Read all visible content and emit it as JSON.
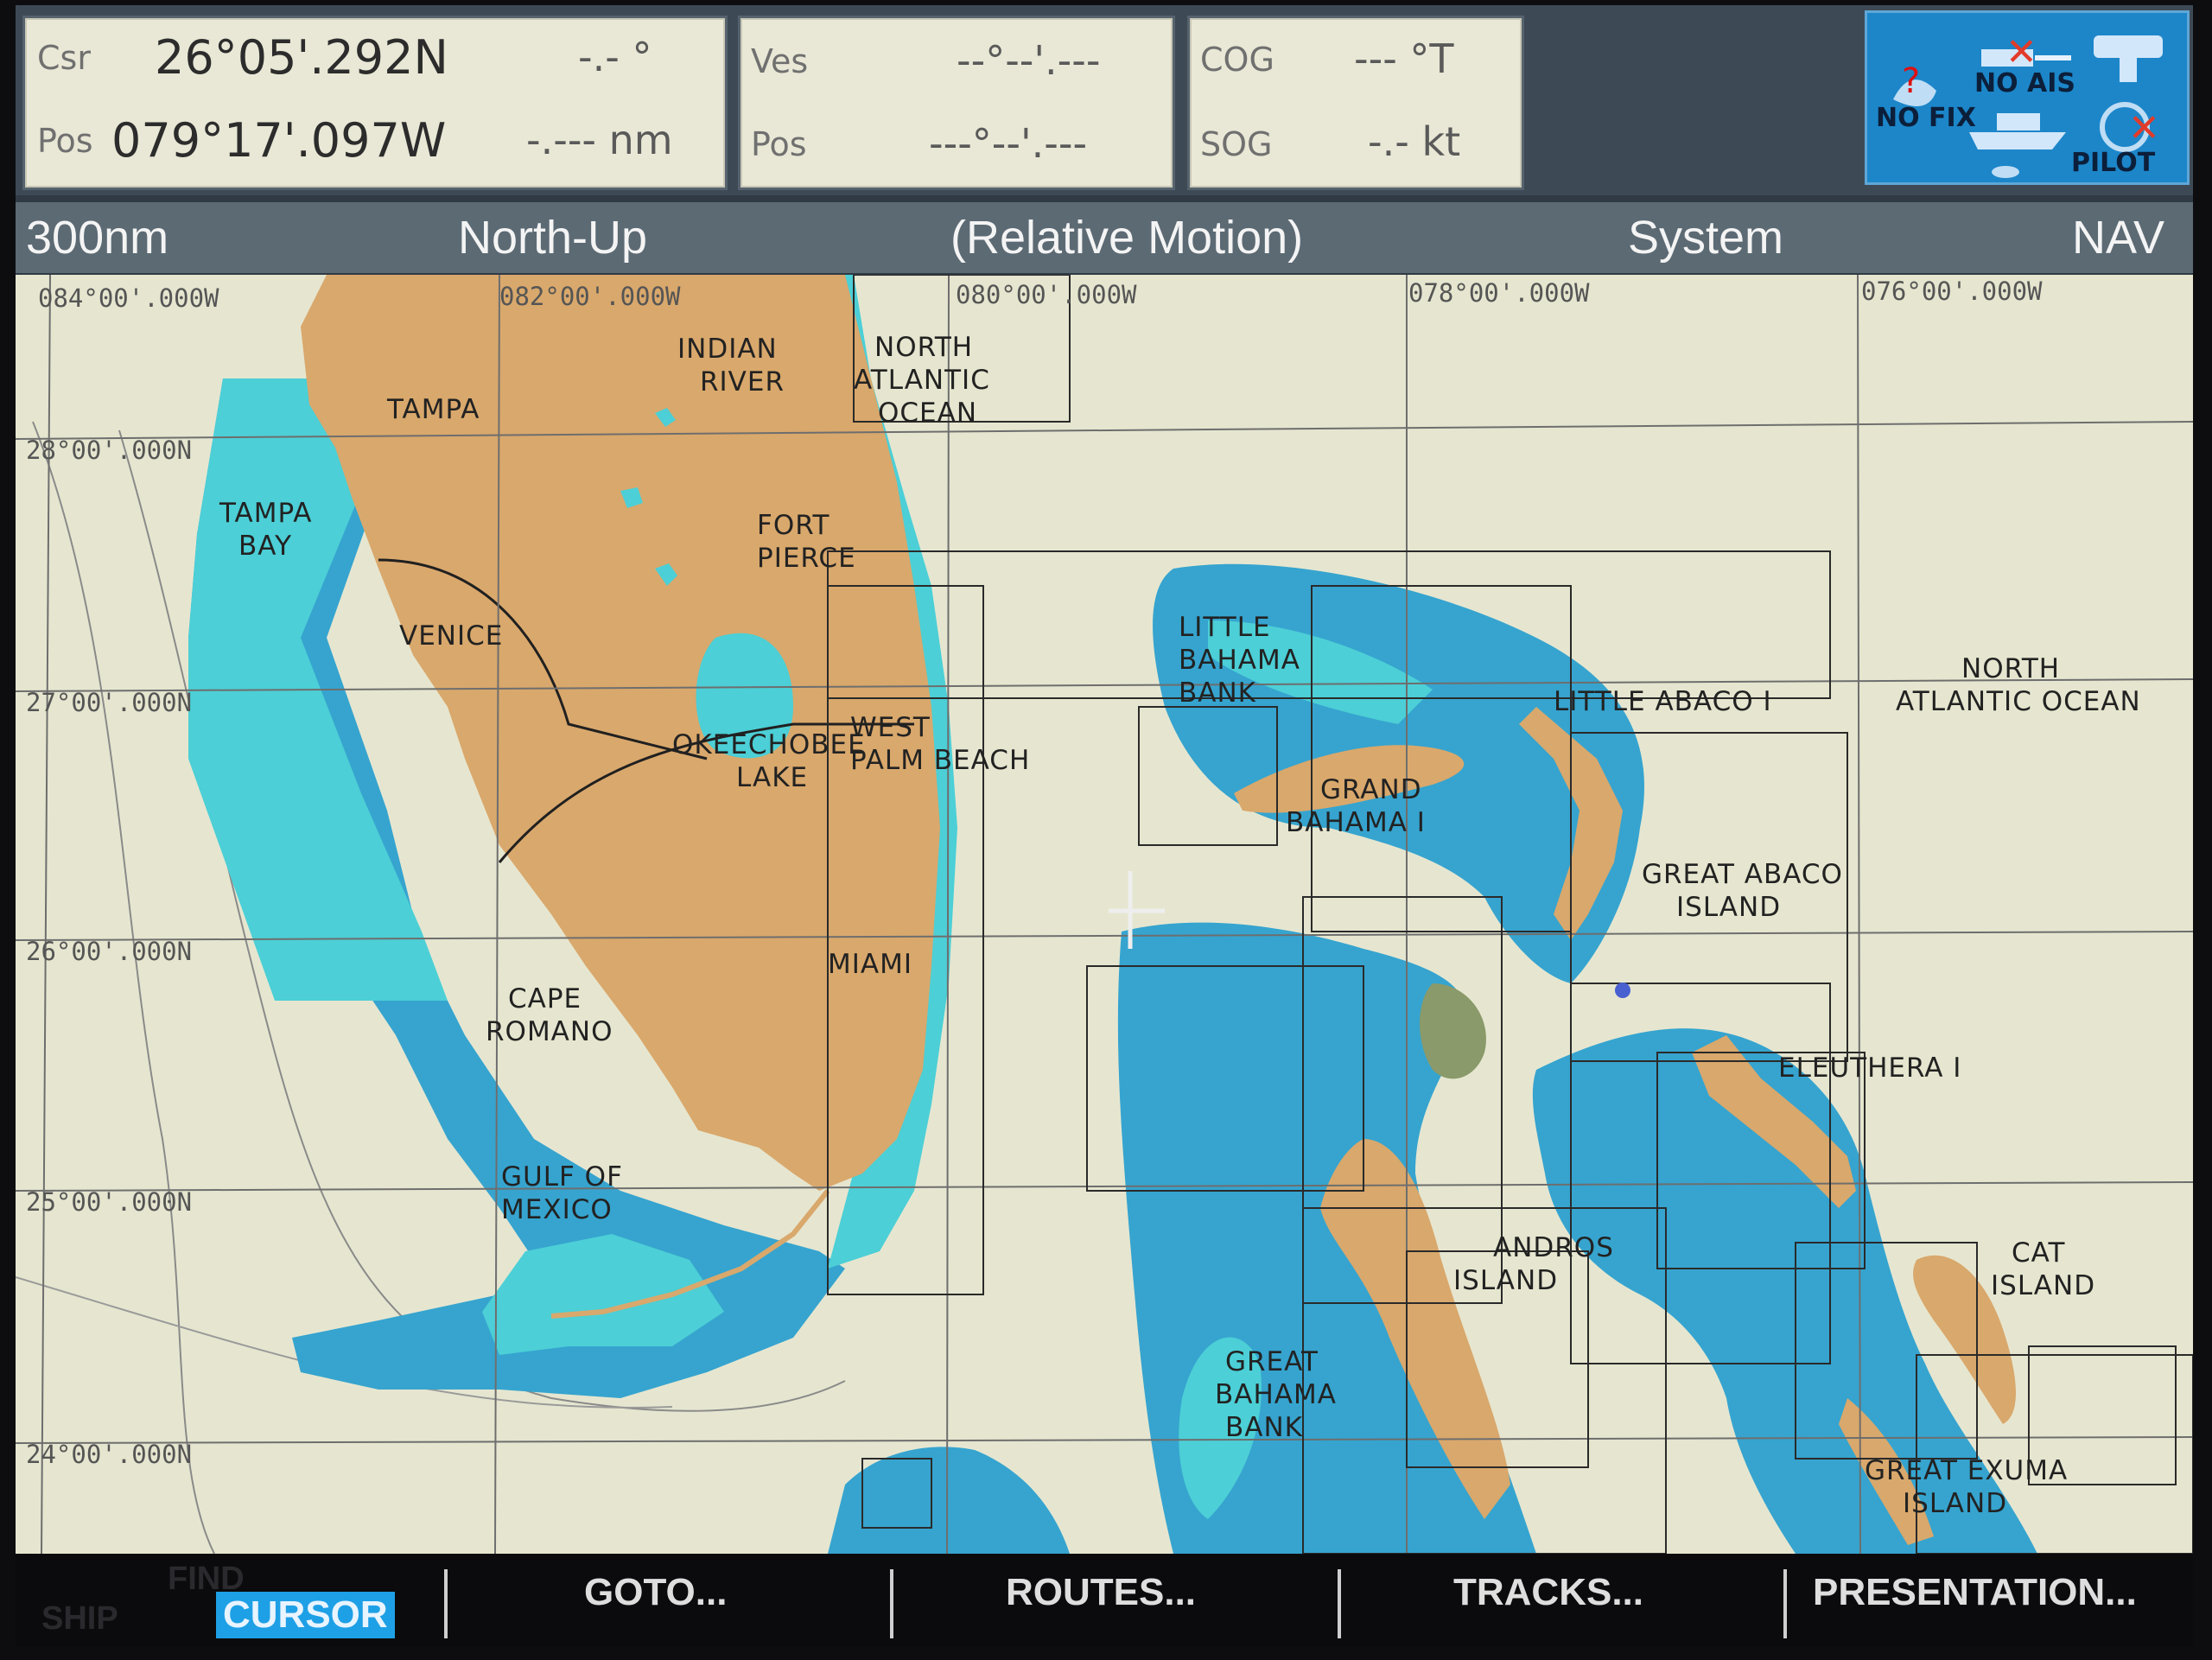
{
  "header": {
    "cursor_lat_label": "Csr",
    "cursor_lat": "26°05'.292N",
    "cursor_bearing": "-.- °",
    "cursor_pos_label": "Pos",
    "cursor_lon": "079°17'.097W",
    "cursor_range": "-.--- nm",
    "ves_label": "Ves",
    "ves_lat": "--°--'.---",
    "pos_label": "Pos",
    "ves_lon": "---°--'.---",
    "cog_label": "COG",
    "cog_value": "--- °T",
    "sog_label": "SOG",
    "sog_value": "-.- kt"
  },
  "status": {
    "ais": "NO AIS",
    "fix": "NO FIX",
    "pilot": "PILOT"
  },
  "modebar": {
    "range": "300nm",
    "orientation": "North-Up",
    "motion": "(Relative Motion)",
    "datum": "System",
    "mode": "NAV"
  },
  "chart": {
    "lon_labels": [
      "084°00'.000W",
      "082°00'.000W",
      "080°00'.000W",
      "078°00'.000W",
      "076°00'.000W"
    ],
    "lat_labels": [
      "28°00'.000N",
      "27°00'.000N",
      "26°00'.000N",
      "25°00'.000N",
      "24°00'.000N"
    ],
    "places": {
      "tampa": "TAMPA",
      "tampa_bay_1": "TAMPA",
      "tampa_bay_2": "BAY",
      "venice": "VENICE",
      "indian_river_1": "INDIAN",
      "indian_river_2": "RIVER",
      "north_atlantic_1": "NORTH",
      "north_atlantic_2": "ATLANTIC",
      "north_atlantic_3": "OCEAN",
      "fort_pierce_1": "FORT",
      "fort_pierce_2": "PIERCE",
      "okeechobee_1": "OKEECHOBEE",
      "okeechobee_2": "LAKE",
      "west_palm_1": "WEST",
      "west_palm_2": "PALM BEACH",
      "miami": "MIAMI",
      "cape_romano_1": "CAPE",
      "cape_romano_2": "ROMANO",
      "gulf_1": "GULF OF",
      "gulf_2": "MEXICO",
      "little_bahama_1": "LITTLE",
      "little_bahama_2": "BAHAMA",
      "little_bahama_3": "BANK",
      "little_abaco": "LITTLE ABACO I",
      "grand_bahama_1": "GRAND",
      "grand_bahama_2": "BAHAMA I",
      "great_abaco_1": "GREAT ABACO",
      "great_abaco_2": "ISLAND",
      "nao_1": "NORTH",
      "nao_2": "ATLANTIC OCEAN",
      "eleuthera": "ELEUTHERA I",
      "andros_1": "ANDROS",
      "andros_2": "ISLAND",
      "gbb_1": "GREAT",
      "gbb_2": "BAHAMA",
      "gbb_3": "BANK",
      "cat_1": "CAT",
      "cat_2": "ISLAND",
      "exuma_1": "GREAT EXUMA",
      "exuma_2": "ISLAND"
    },
    "colors": {
      "land": "#d9a86c",
      "shallow": "#4ccfd6",
      "medium": "#36a4cf",
      "deep": "#2b8fcd",
      "water": "#e6e6d0"
    }
  },
  "softkeys": {
    "ship": "SHIP",
    "find": "FIND",
    "cursor": "CURSOR",
    "goto": "GOTO...",
    "routes": "ROUTES...",
    "tracks": "TRACKS...",
    "presentation": "PRESENTATION..."
  }
}
